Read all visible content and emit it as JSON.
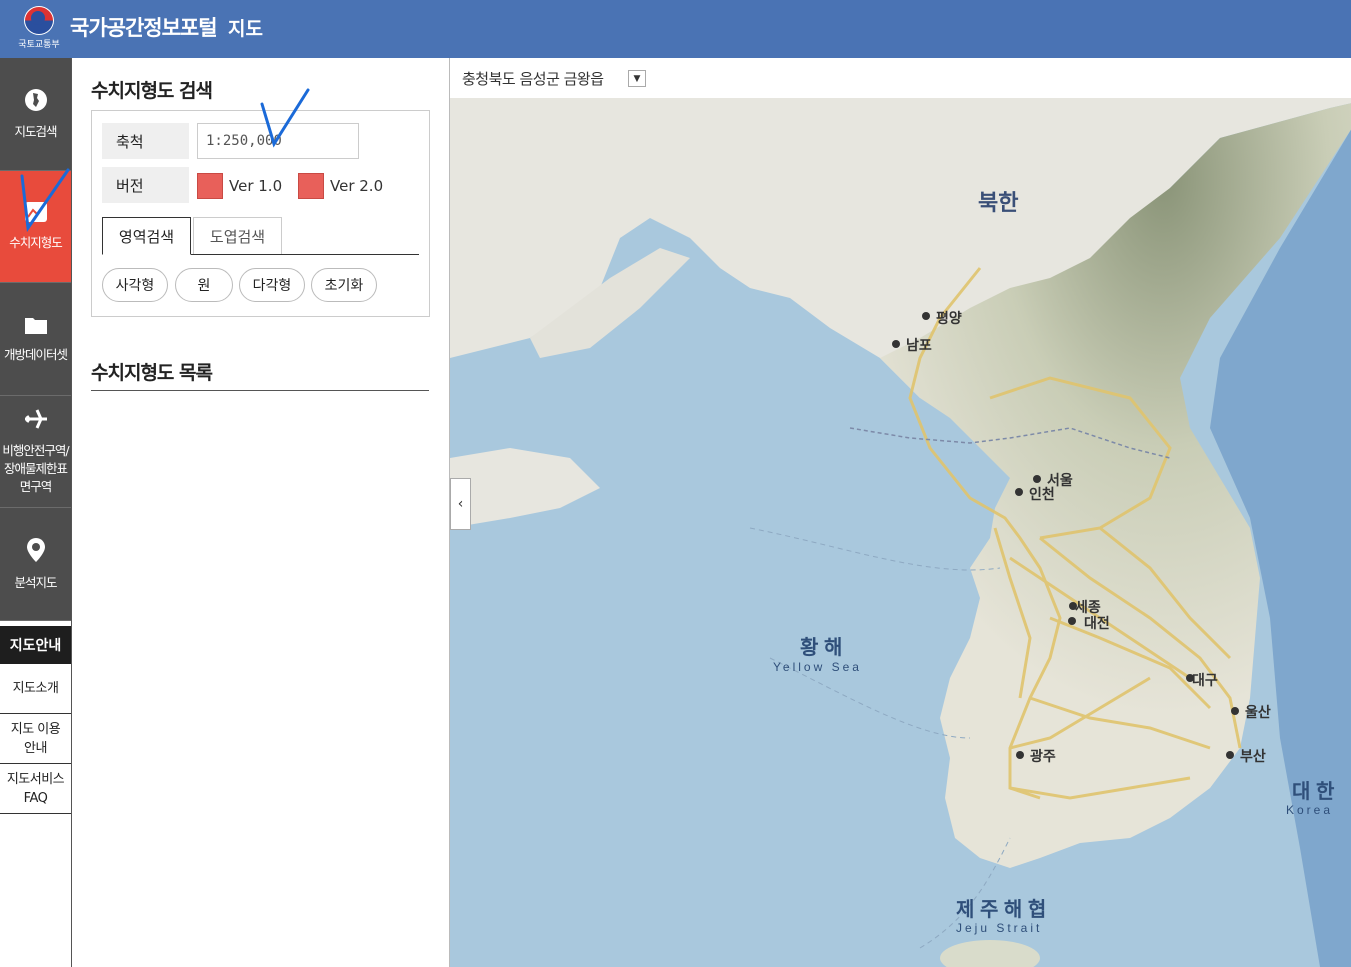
{
  "header": {
    "logo_sub": "국토교통부",
    "title": "국가공간정보포털",
    "subtitle": "지도"
  },
  "nav": {
    "items": [
      {
        "label": "지도검색",
        "icon": "korea-map-icon"
      },
      {
        "label": "수치지형도",
        "icon": "chart-icon"
      },
      {
        "label": "개방데이터셋",
        "icon": "folder-icon"
      },
      {
        "label": "비행안전구역/장애물제한표면구역",
        "icon": "airplane-icon"
      },
      {
        "label": "분석지도",
        "icon": "location-pin-icon"
      }
    ],
    "guide": "지도안내",
    "sub_items": [
      "지도소개",
      "지도 이용안내",
      "지도서비스 FAQ"
    ]
  },
  "panel": {
    "search_title": "수치지형도 검색",
    "scale_label": "축척",
    "scale_value": "1:250,000",
    "version_label": "버전",
    "ver1": "Ver 1.0",
    "ver2": "Ver 2.0",
    "tabs": [
      "영역검색",
      "도엽검색"
    ],
    "buttons": [
      "사각형",
      "원",
      "다각형",
      "초기화"
    ],
    "list_title": "수치지형도 목록"
  },
  "map": {
    "location": "충청북도 음성군 금왕읍",
    "labels": {
      "north": "북한",
      "pyongyang": "평양",
      "nampo": "남포",
      "seoul": "서울",
      "incheon": "인천",
      "sejong": "세종",
      "daejeon": "대전",
      "daegu": "대구",
      "ulsan": "울산",
      "gwangju": "광주",
      "busan": "부산",
      "yellow_sea_ko": "황 해",
      "yellow_sea_en": "Yellow Sea",
      "jeju_strait_ko": "제 주 해 협",
      "jeju_strait_en": "Jeju Strait",
      "east_ko": "대 한",
      "east_en": "Korea"
    }
  },
  "colors": {
    "header": "#4a73b4",
    "nav_active": "#e84b3c",
    "nav_bg": "#4d4d4d",
    "version_swatch": "#e8605a"
  }
}
